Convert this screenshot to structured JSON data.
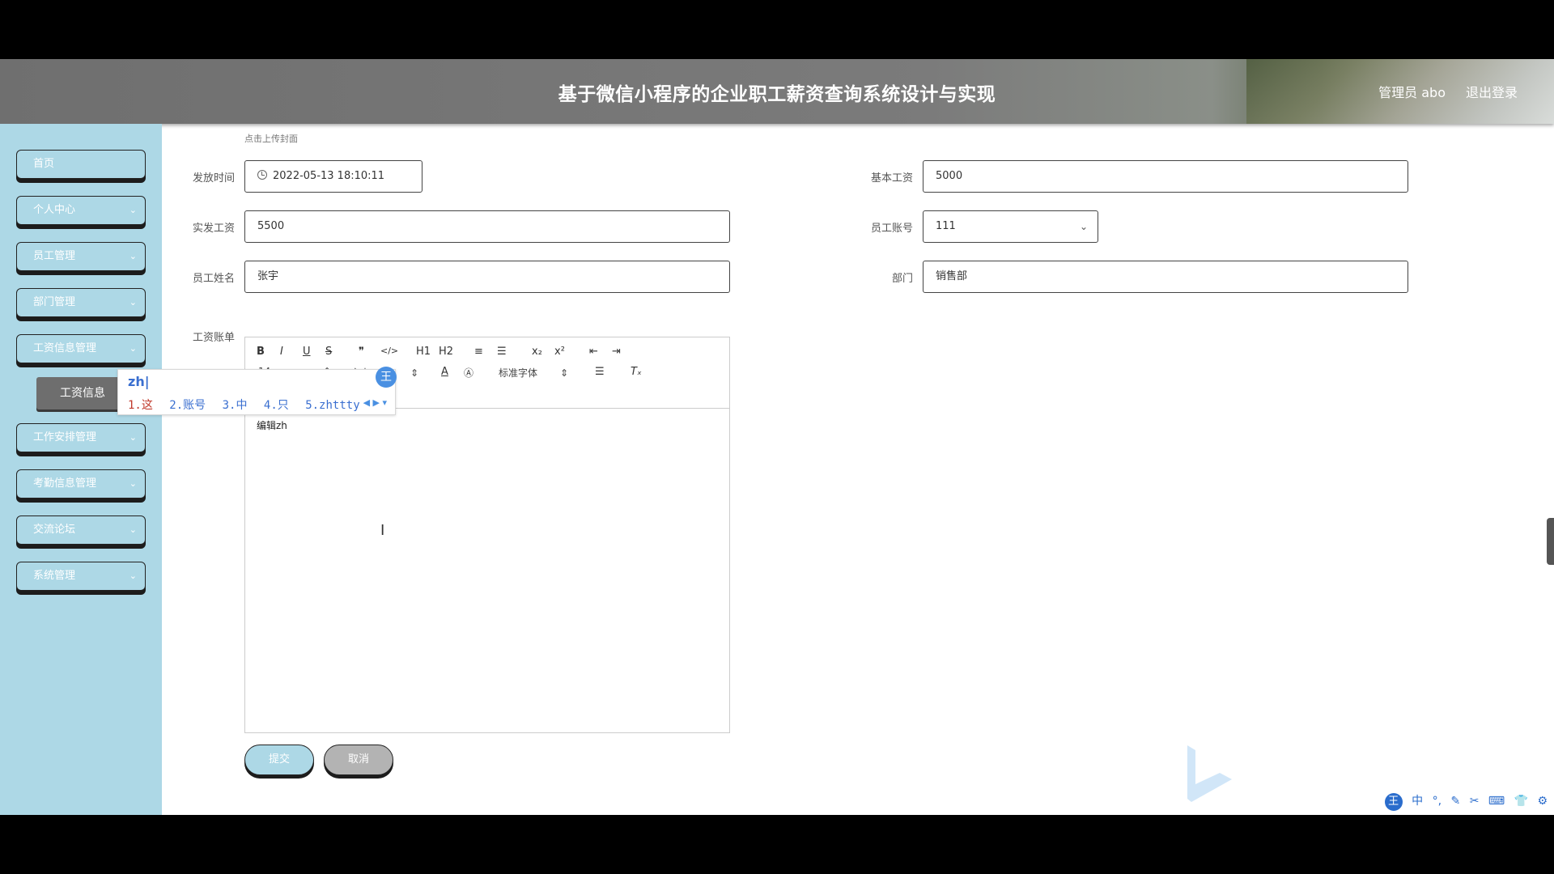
{
  "header": {
    "title": "基于微信小程序的企业职工薪资查询系统设计与实现",
    "user": "管理员 abo",
    "logout": "退出登录"
  },
  "sidebar": {
    "items": [
      {
        "label": "首页",
        "has_arrow": false
      },
      {
        "label": "个人中心",
        "has_arrow": true
      },
      {
        "label": "员工管理",
        "has_arrow": true
      },
      {
        "label": "部门管理",
        "has_arrow": true
      },
      {
        "label": "工资信息管理",
        "has_arrow": true
      },
      {
        "label": "工作安排管理",
        "has_arrow": true
      },
      {
        "label": "考勤信息管理",
        "has_arrow": true
      },
      {
        "label": "交流论坛",
        "has_arrow": true
      },
      {
        "label": "系统管理",
        "has_arrow": true
      }
    ],
    "subitem": "工资信息"
  },
  "form": {
    "upload_hint": "点击上传封面",
    "release_time": {
      "label": "发放时间",
      "value": "2022-05-13 18:10:11"
    },
    "base_salary": {
      "label": "基本工资",
      "value": "5000"
    },
    "actual_salary": {
      "label": "实发工资",
      "value": "5500"
    },
    "employee_account": {
      "label": "员工账号",
      "value": "111"
    },
    "employee_name": {
      "label": "员工姓名",
      "value": "张宇"
    },
    "department": {
      "label": "部门",
      "value": "销售部"
    },
    "salary_bill": {
      "label": "工资账单"
    }
  },
  "editor": {
    "toolbar_row1": [
      "B",
      "I",
      "U",
      "S",
      "❞",
      "</>",
      "H1",
      "H2",
      "≡",
      "☰",
      "x₂",
      "x²",
      "⇤",
      "⇥"
    ],
    "font_size": "14px",
    "text_type": "文本",
    "font_family": "标准字体",
    "content": "编辑zh"
  },
  "ime": {
    "composition": "zh|",
    "candidates": [
      "1.这",
      "2.账号",
      "3.中",
      "4.只",
      "5.zhttty"
    ],
    "badge": "王"
  },
  "buttons": {
    "submit": "提交",
    "cancel": "取消"
  },
  "tray": {
    "badge": "王",
    "items": [
      "中",
      "°,",
      "✎",
      "✂",
      "⌨",
      "👕",
      "⚙"
    ]
  }
}
